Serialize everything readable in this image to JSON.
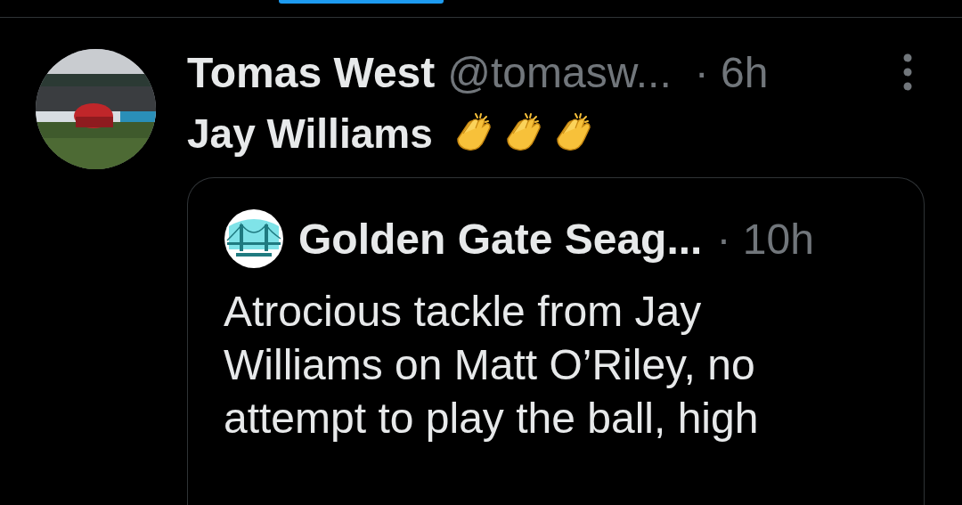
{
  "tabs": {
    "indicator": {
      "selected": true
    }
  },
  "tweet": {
    "author": {
      "name": "Tomas West",
      "handle": "@tomasw...",
      "time": "· 6h"
    },
    "text": "Jay Williams",
    "quote": {
      "author": {
        "name": "Golden Gate Seag...",
        "time": "· 10h"
      },
      "text": "Atrocious tackle from Jay Williams on Matt O’Riley, no attempt to play the ball, high"
    }
  }
}
